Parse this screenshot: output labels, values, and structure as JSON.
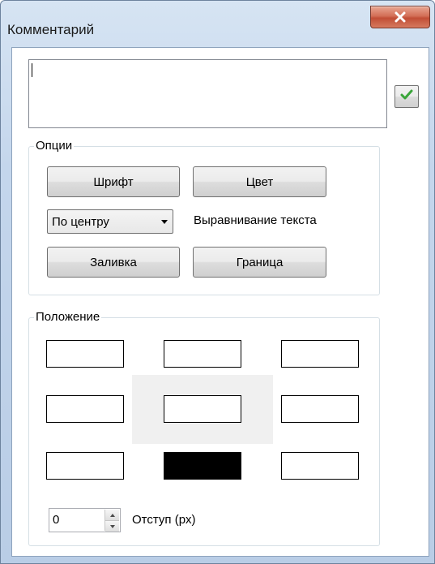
{
  "window": {
    "title": "Комментарий"
  },
  "comment": {
    "value": ""
  },
  "options": {
    "legend": "Опции",
    "font_button": "Шрифт",
    "color_button": "Цвет",
    "alignment_selected": "По центру",
    "alignment_label": "Выравнивание текста",
    "fill_button": "Заливка",
    "border_button": "Граница"
  },
  "position": {
    "legend": "Положение",
    "selected": "bottom-center",
    "indent_value": "0",
    "indent_label": "Отступ (px)"
  },
  "icons": {
    "close": "close-icon",
    "apply": "checkmark-icon",
    "dropdown": "chevron-down-icon",
    "spin_up": "arrow-up-icon",
    "spin_down": "arrow-down-icon"
  },
  "colors": {
    "checkmark": "#3aa53a",
    "close_button": "#c14e36",
    "selected_cell": "#000000"
  }
}
